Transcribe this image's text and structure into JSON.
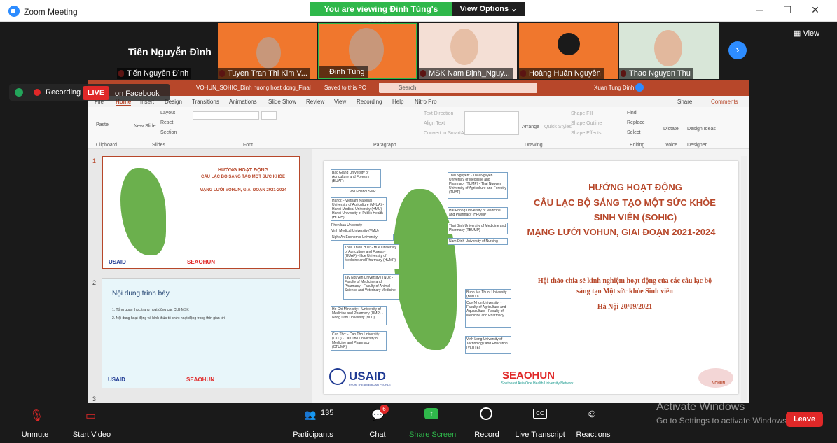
{
  "window": {
    "title": "Zoom Meeting"
  },
  "banner": {
    "viewing": "You are viewing Đinh Tùng's screen",
    "view_options": "View Options"
  },
  "gallery": {
    "featured_name": "Tiến Nguyễn Đình",
    "view_label": "View",
    "tiles": [
      {
        "name": "Tiến Nguyễn Đình"
      },
      {
        "name": "Tuyen Tran Thi Kim V..."
      },
      {
        "name": "Đinh Tùng"
      },
      {
        "name": "MSK Nam Định_Nguy..."
      },
      {
        "name": "Hoàng Huân Nguyễn"
      },
      {
        "name": "Thao Nguyen Thu"
      }
    ]
  },
  "status": {
    "recording": "Recording",
    "live": "LIVE",
    "live_target": "on Facebook"
  },
  "ppt": {
    "file_name": "VOHUN_SOHIC_Dinh huong hoat dong_Final",
    "saved": "Saved to this PC",
    "search": "Search",
    "user": "Xuan Tung Dinh",
    "tabs": [
      "File",
      "Home",
      "Insert",
      "Design",
      "Transitions",
      "Animations",
      "Slide Show",
      "Review",
      "View",
      "Recording",
      "Help",
      "Nitro Pro"
    ],
    "share": "Share",
    "comments": "Comments",
    "groups": [
      "Clipboard",
      "Slides",
      "Font",
      "Paragraph",
      "Drawing",
      "Editing",
      "Voice",
      "Designer"
    ],
    "ribbon_buttons": {
      "paste": "Paste",
      "new_slide": "New Slide",
      "layout": "Layout",
      "reset": "Reset",
      "section": "Section",
      "text_direction": "Text Direction",
      "align_text": "Align Text",
      "convert": "Convert to SmartArt",
      "arrange": "Arrange",
      "quick_styles": "Quick Styles",
      "shape_fill": "Shape Fill",
      "shape_outline": "Shape Outline",
      "shape_effects": "Shape Effects",
      "find": "Find",
      "replace": "Replace",
      "select": "Select",
      "dictate": "Dictate",
      "design_ideas": "Design Ideas"
    }
  },
  "slides": {
    "nums": [
      "1",
      "2",
      "3"
    ],
    "slide2_title": "Nội dung trình bày",
    "slide2_items": [
      "1.   Tổng quan thực trạng hoạt động các CLB MSK",
      "2.   Nội dung hoạt động và hình thức tổ chức hoạt động trong thời gian tới"
    ]
  },
  "main_slide": {
    "title1": "HƯỚNG HOẠT ĐỘNG",
    "title2": "CÂU LẠC BỘ SÁNG TẠO MỘT SỨC KHỎE",
    "title3": "SINH VIÊN (SOHIC)",
    "title4": "MẠNG LƯỚI VOHUN, GIAI ĐOẠN 2021-2024",
    "sub1": "Hội thảo chia sẻ kinh nghiệm hoạt động của các câu lạc bộ",
    "sub2": "sáng tạo Một sức khỏe Sinh viên",
    "date": "Hà Nội 20/09/2021",
    "usaid": "USAID",
    "usaid_sub": "FROM THE AMERICAN PEOPLE",
    "seahun": "SEAOHUN",
    "seahun_sub": "Southeast Asia One Health University Network",
    "vohun": "VOHUN",
    "boxes": {
      "b1": "Bac Giang University of Agriculture and Forestry (BUAF)",
      "b2": "VNU-Hanoi SMP",
      "b3": "Hanoi: - Vietnam National University of Agriculture (VNUA) - Hanoi Medical University (HMU) - Hanoi University of Public Health (HUPH)",
      "b4": "Phenikaa University",
      "b5": "Vinh Medical University (VMU)",
      "b6": "NgheAn Economic University",
      "b7": "Thua Thien Hue: - Hue University of Agriculture and Forestry (HUAF) - Hue University of Medicine and Pharmacy (HUMP)",
      "b8": "Tay Nguyen University (TNU): - Faculty of Medicine and Pharmacy - Faculty of Animal Science and Veterinary Medicine",
      "b9": "Ho Chi Minh city: - University of Medicine and Pharmacy (UMP) - Nong Lam University (NLU)",
      "b10": "Can Tho: - Can Tho University (CTU) - Can Tho University of Medicine and Pharmacy (CTUMP)",
      "r1": "Thai Nguyen: - Thai Nguyen University of Medicine and Pharmacy (TUMP) - Thai Nguyen University of Agriculture and Forestry (TUAF)",
      "r2": "Hai Phong University of Medicine and Pharmacy (HPUMP)",
      "r3": "Thai Binh University of Medicine and Pharmacy (TBUMP)",
      "r4": "Nam Dinh University of Nursing",
      "r5": "Buon Ma Thuot University (BMTU)",
      "r6": "Quy Nhon University: - Faculty of Agriculture and Aquaculture - Faculty of Medicine and Pharmacy",
      "r7": "Vinh Long University of Technology and Education (VLUTE)"
    }
  },
  "toolbar": {
    "unmute": "Unmute",
    "start_video": "Start Video",
    "participants": "Participants",
    "participant_count": "135",
    "chat": "Chat",
    "chat_badge": "6",
    "share_screen": "Share Screen",
    "record": "Record",
    "live_transcript": "Live Transcript",
    "reactions": "Reactions",
    "leave": "Leave"
  },
  "watermark": {
    "line1": "Activate Windows",
    "line2": "Go to Settings to activate Windows."
  },
  "colors": {
    "zoom_blue": "#2d8cff",
    "share_green": "#2fb84b",
    "ppt_red": "#b7472a",
    "leave_red": "#e02828"
  }
}
